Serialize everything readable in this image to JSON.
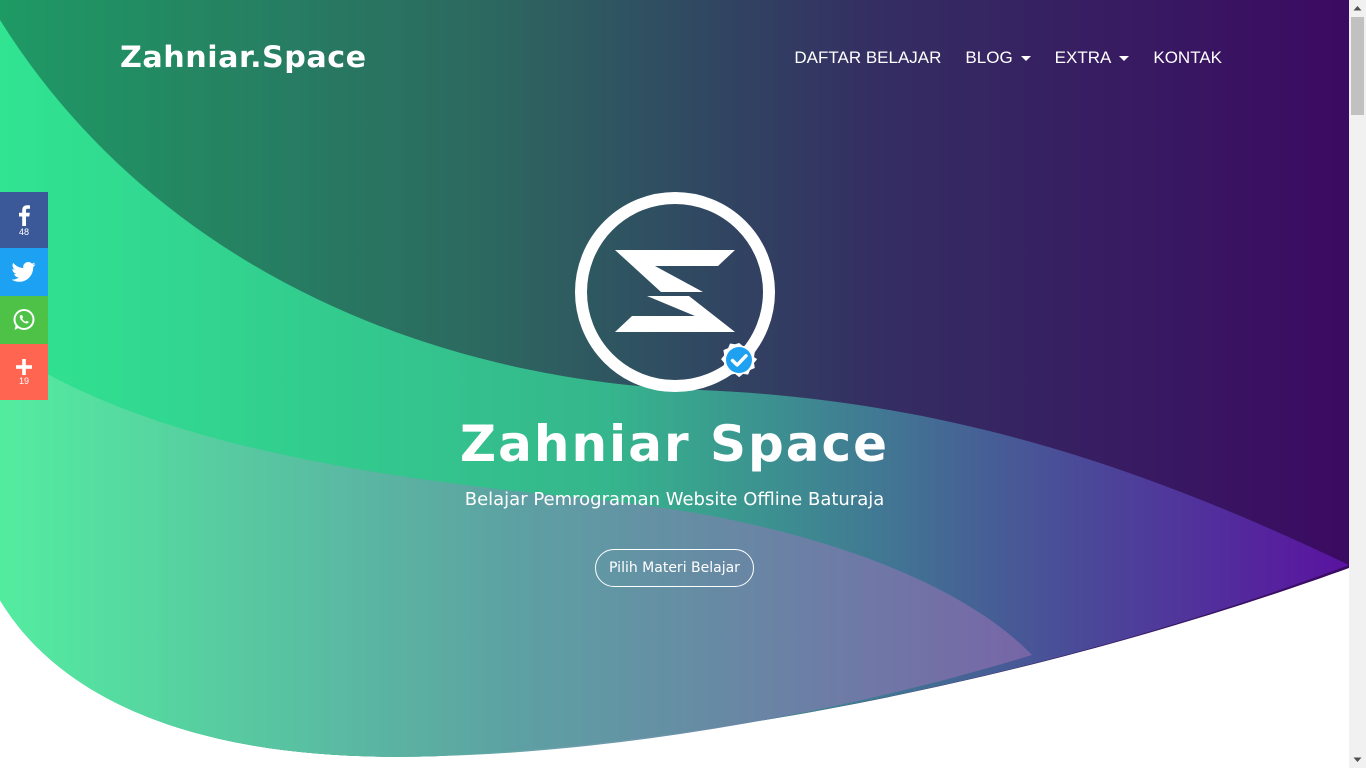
{
  "navbar": {
    "brand": "Zahniar.Space",
    "links": [
      {
        "label": "DAFTAR BELAJAR",
        "dropdown": false
      },
      {
        "label": "BLOG",
        "dropdown": true
      },
      {
        "label": "EXTRA",
        "dropdown": true
      },
      {
        "label": "KONTAK",
        "dropdown": false
      }
    ]
  },
  "share_bar": {
    "buttons": [
      {
        "icon": "facebook-icon",
        "count": "48",
        "color": "#3b5998"
      },
      {
        "icon": "twitter-icon",
        "count": "",
        "color": "#1da1f2"
      },
      {
        "icon": "whatsapp-icon",
        "count": "",
        "color": "#4dc247"
      },
      {
        "icon": "plus-icon",
        "count": "19",
        "color": "#ff6550"
      }
    ]
  },
  "hero": {
    "logo_icon": "zahniar-logo-icon",
    "badge_icon": "verified-badge-icon",
    "title": "Zahniar Space",
    "subtitle": "Belajar Pemrograman Website Offline Baturaja",
    "cta_label": "Pilih Materi Belajar"
  },
  "colors": {
    "green": "#2ee58f",
    "teal": "#2b6c60",
    "purple": "#3a0a62",
    "violet": "#5a0f9a",
    "verified_blue": "#1ea1f1"
  }
}
